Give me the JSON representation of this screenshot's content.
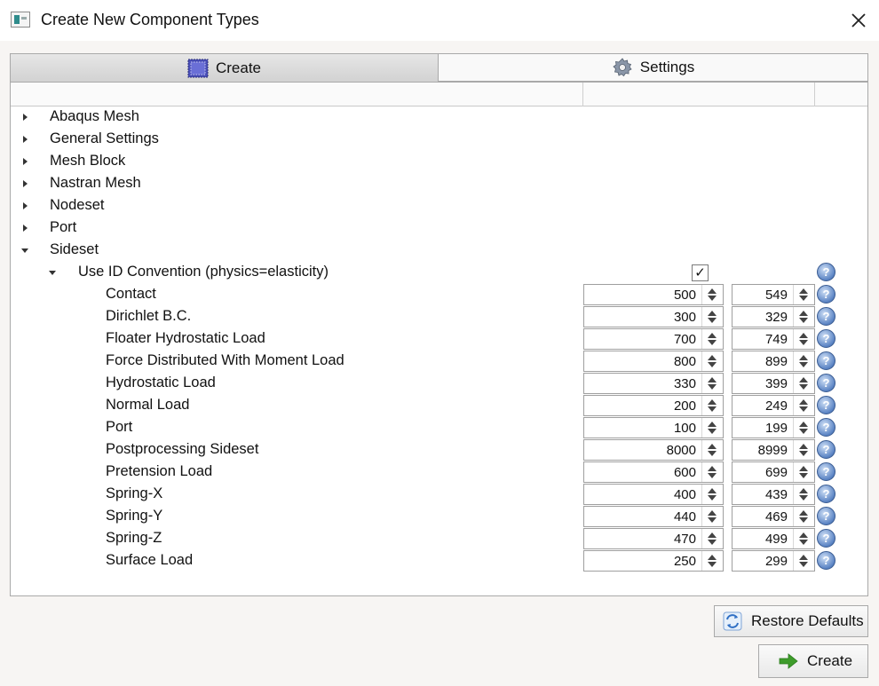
{
  "window": {
    "title": "Create New Component Types",
    "close_label": "✕"
  },
  "tabs": [
    {
      "label": "Create",
      "icon": "create-icon",
      "active": true
    },
    {
      "label": "Settings",
      "icon": "gear-icon",
      "active": false
    }
  ],
  "tree": {
    "top_items": [
      {
        "label": "Abaqus Mesh",
        "expanded": false
      },
      {
        "label": "General Settings",
        "expanded": false
      },
      {
        "label": "Mesh Block",
        "expanded": false
      },
      {
        "label": "Nastran Mesh",
        "expanded": false
      },
      {
        "label": "Nodeset",
        "expanded": false
      },
      {
        "label": "Port",
        "expanded": false
      },
      {
        "label": "Sideset",
        "expanded": true
      }
    ],
    "convention": {
      "label": "Use ID Convention (physics=elasticity)",
      "checked": true,
      "check_glyph": "✓",
      "help": "?"
    },
    "items": [
      {
        "label": "Contact",
        "start": "500",
        "end": "549"
      },
      {
        "label": "Dirichlet B.C.",
        "start": "300",
        "end": "329"
      },
      {
        "label": "Floater Hydrostatic Load",
        "start": "700",
        "end": "749"
      },
      {
        "label": "Force Distributed With Moment Load",
        "start": "800",
        "end": "899"
      },
      {
        "label": "Hydrostatic Load",
        "start": "330",
        "end": "399"
      },
      {
        "label": "Normal Load",
        "start": "200",
        "end": "249"
      },
      {
        "label": "Port",
        "start": "100",
        "end": "199"
      },
      {
        "label": "Postprocessing Sideset",
        "start": "8000",
        "end": "8999"
      },
      {
        "label": "Pretension Load",
        "start": "600",
        "end": "699"
      },
      {
        "label": "Spring-X",
        "start": "400",
        "end": "439"
      },
      {
        "label": "Spring-Y",
        "start": "440",
        "end": "469"
      },
      {
        "label": "Spring-Z",
        "start": "470",
        "end": "499"
      },
      {
        "label": "Surface Load",
        "start": "250",
        "end": "299"
      }
    ],
    "help_glyph": "?"
  },
  "buttons": {
    "restore_label": "Restore Defaults",
    "create_label": "Create"
  },
  "colors": {
    "accent_help": "#5b84c4",
    "create_arrow": "#3e9c2b"
  }
}
